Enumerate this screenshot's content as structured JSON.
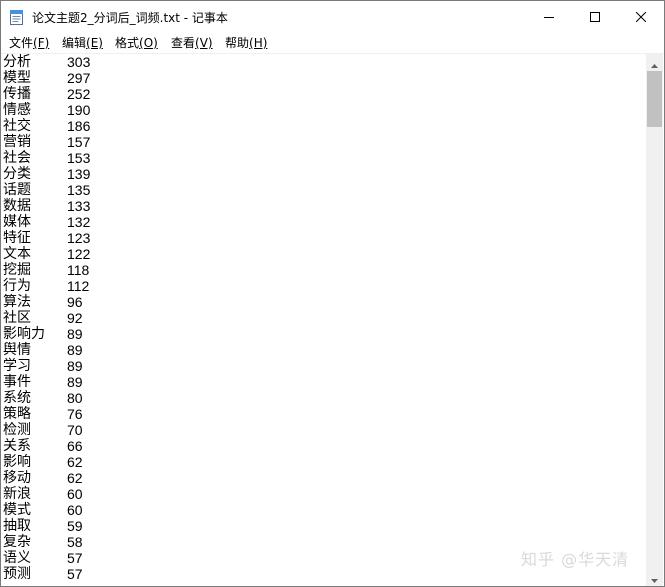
{
  "window": {
    "title": "论文主题2_分词后_词频.txt - 记事本"
  },
  "menubar": {
    "items": [
      {
        "label": "文件",
        "shortcut": "(F)"
      },
      {
        "label": "编辑",
        "shortcut": "(E)"
      },
      {
        "label": "格式",
        "shortcut": "(O)"
      },
      {
        "label": "查看",
        "shortcut": "(V)"
      },
      {
        "label": "帮助",
        "shortcut": "(H)"
      }
    ]
  },
  "content": {
    "lines": [
      {
        "word": "分析",
        "count": "303"
      },
      {
        "word": "模型",
        "count": "297"
      },
      {
        "word": "传播",
        "count": "252"
      },
      {
        "word": "情感",
        "count": "190"
      },
      {
        "word": "社交",
        "count": "186"
      },
      {
        "word": "营销",
        "count": "157"
      },
      {
        "word": "社会",
        "count": "153"
      },
      {
        "word": "分类",
        "count": "139"
      },
      {
        "word": "话题",
        "count": "135"
      },
      {
        "word": "数据",
        "count": "133"
      },
      {
        "word": "媒体",
        "count": "132"
      },
      {
        "word": "特征",
        "count": "123"
      },
      {
        "word": "文本",
        "count": "122"
      },
      {
        "word": "挖掘",
        "count": "118"
      },
      {
        "word": "行为",
        "count": "112"
      },
      {
        "word": "算法",
        "count": "96"
      },
      {
        "word": "社区",
        "count": "92"
      },
      {
        "word": "影响力",
        "count": "89"
      },
      {
        "word": "舆情",
        "count": "89"
      },
      {
        "word": "学习",
        "count": "89"
      },
      {
        "word": "事件",
        "count": "89"
      },
      {
        "word": "系统",
        "count": "80"
      },
      {
        "word": "策略",
        "count": "76"
      },
      {
        "word": "检测",
        "count": "70"
      },
      {
        "word": "关系",
        "count": "66"
      },
      {
        "word": "影响",
        "count": "62"
      },
      {
        "word": "移动",
        "count": "62"
      },
      {
        "word": "新浪",
        "count": "60"
      },
      {
        "word": "模式",
        "count": "60"
      },
      {
        "word": "抽取",
        "count": "59"
      },
      {
        "word": "复杂",
        "count": "58"
      },
      {
        "word": "语义",
        "count": "57"
      },
      {
        "word": "预测",
        "count": "57"
      }
    ]
  },
  "watermark": {
    "text": "知乎 @华天清"
  },
  "colors": {
    "text": "#000000",
    "scrollbar_track": "#f0f0f0",
    "scrollbar_thumb": "#c1c1c1",
    "watermark": "#d9d9d9"
  }
}
